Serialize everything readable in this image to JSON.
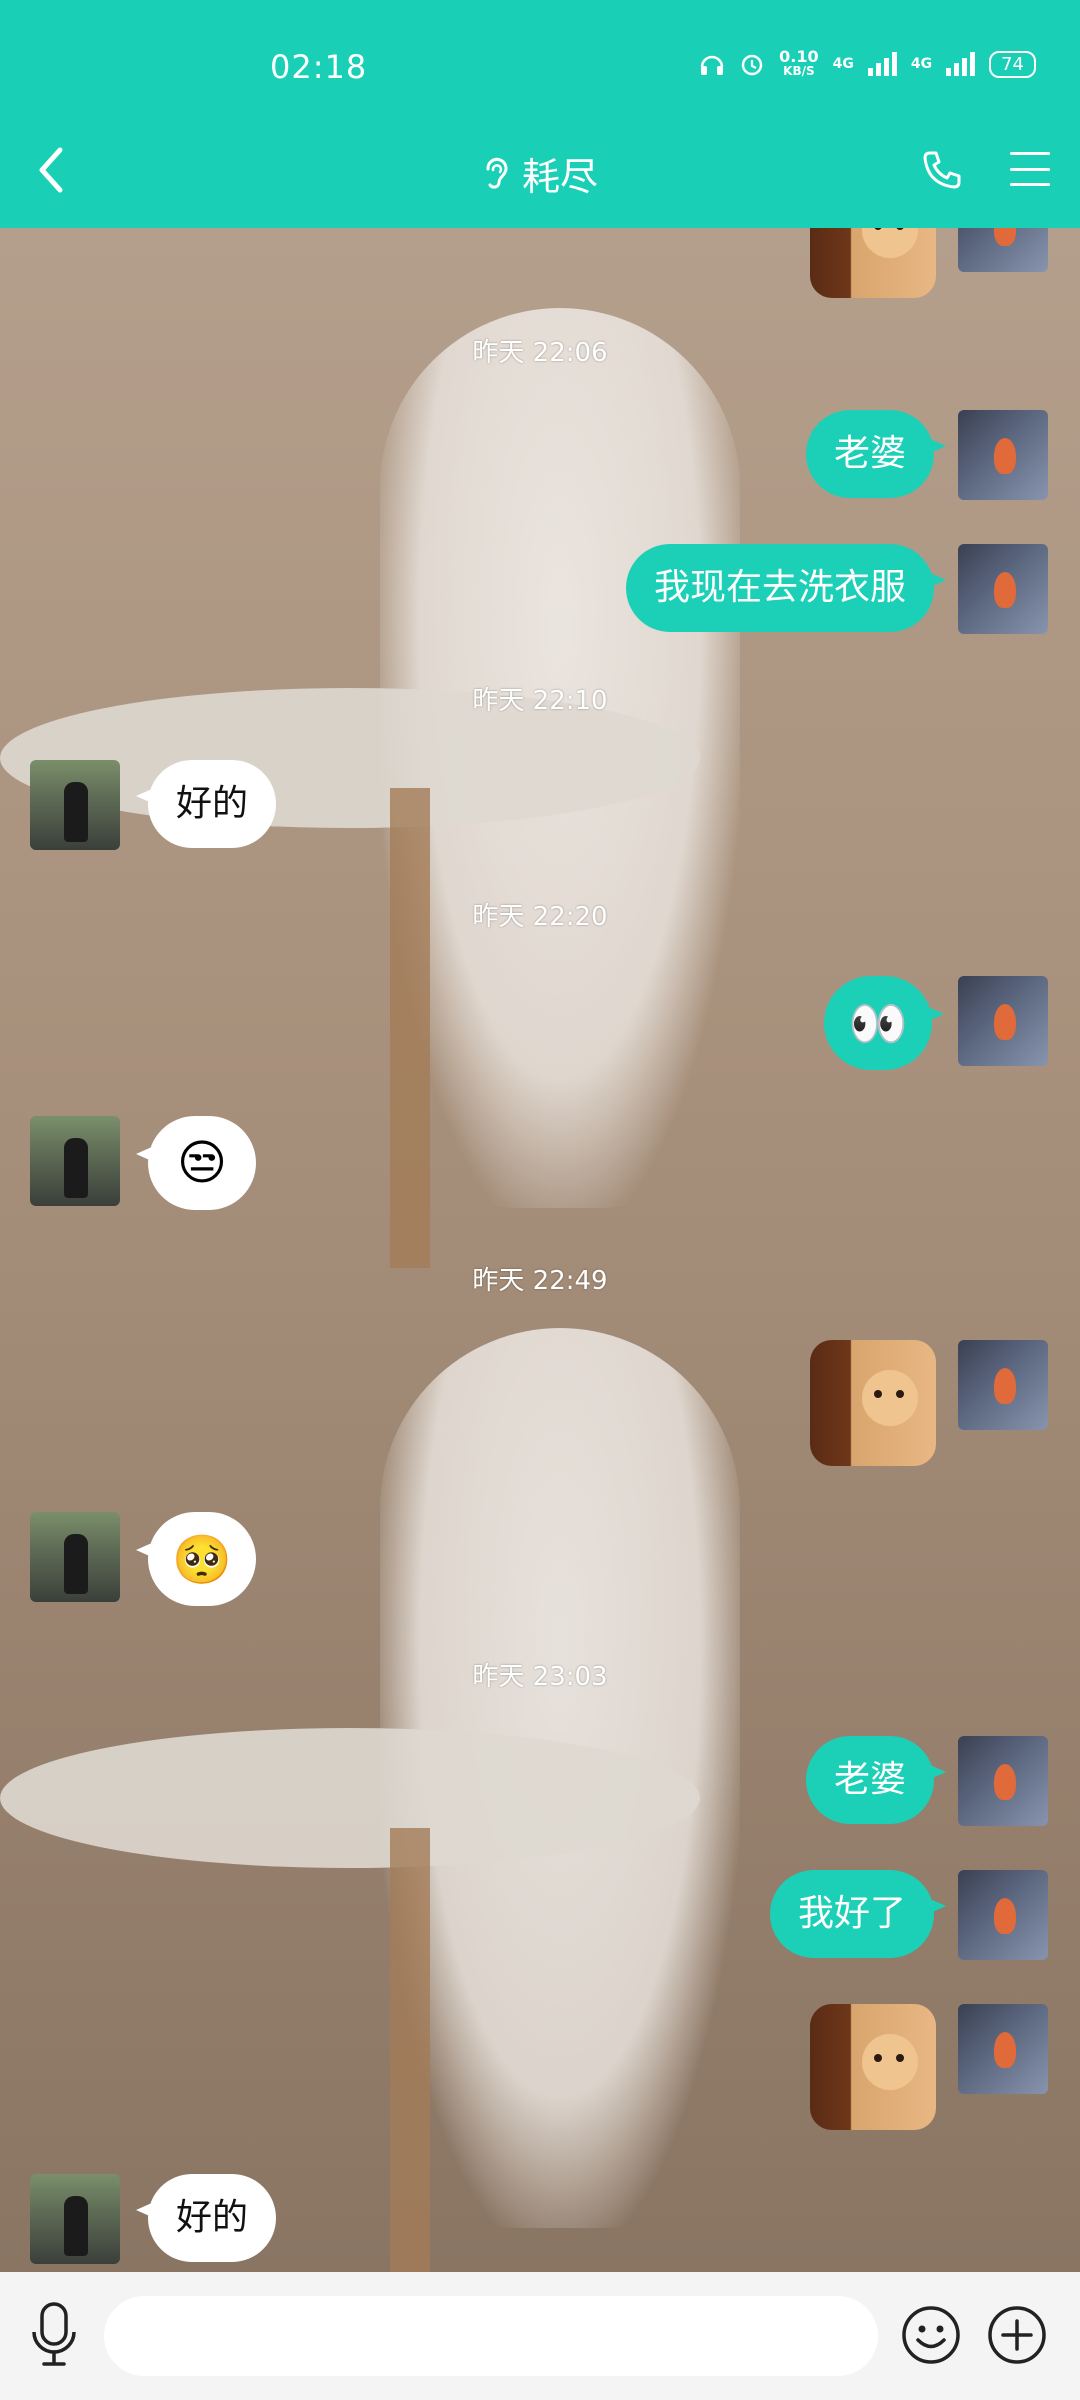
{
  "status_bar": {
    "time": "02:18",
    "net_speed_top": "0.10",
    "net_speed_unit": "KB/S",
    "net1": "4G",
    "net2": "4G",
    "battery": "74"
  },
  "header": {
    "title": "耗尽"
  },
  "messages": {
    "ts1": "昨天 22:06",
    "m1": "老婆",
    "m2": "我现在去洗衣服",
    "ts2": "昨天 22:10",
    "m3": "好的",
    "ts3": "昨天 22:20",
    "m4_emoji": "👀",
    "m5_emoji": "😒",
    "ts4": "昨天 22:49",
    "m7_emoji": "🥺",
    "ts5": "昨天 23:03",
    "m8": "老婆",
    "m9": "我好了",
    "m11": "好的"
  },
  "colors": {
    "accent": "#19d0b7",
    "bubble_out": "#1ccfb7",
    "bubble_in": "#ffffff"
  },
  "input": {
    "placeholder": ""
  }
}
